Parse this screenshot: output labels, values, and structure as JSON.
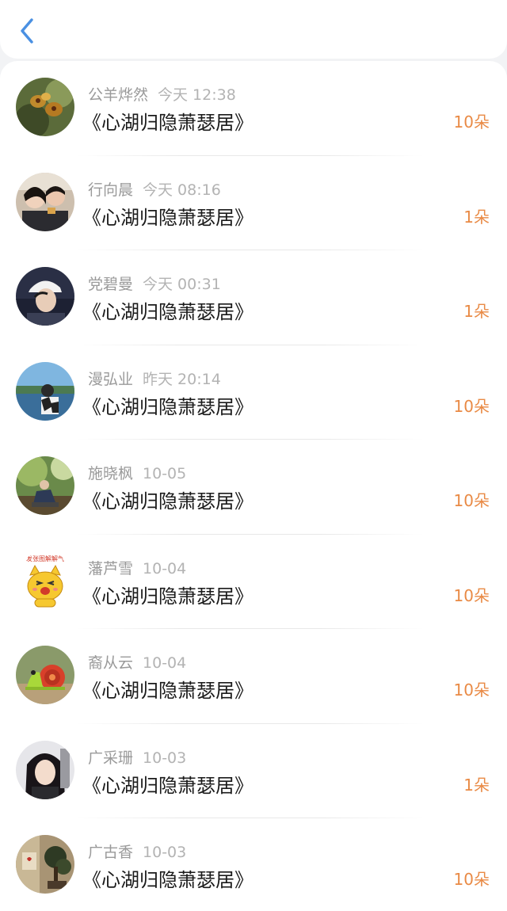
{
  "header": {
    "back_icon": "chevron-left-icon"
  },
  "list": [
    {
      "name": "公羊烨然",
      "time": "今天 12:38",
      "title": "《心湖归隐萧瑟居》",
      "count": "10朵",
      "avatar": "flower-photo"
    },
    {
      "name": "行向晨",
      "time": "今天 08:16",
      "title": "《心湖归隐萧瑟居》",
      "count": "1朵",
      "avatar": "couple-photo"
    },
    {
      "name": "党碧曼",
      "time": "今天 00:31",
      "title": "《心湖归隐萧瑟居》",
      "count": "1朵",
      "avatar": "man-cap-photo"
    },
    {
      "name": "漫弘业",
      "time": "昨天 20:14",
      "title": "《心湖归隐萧瑟居》",
      "count": "10朵",
      "avatar": "lake-photo"
    },
    {
      "name": "施晓枫",
      "time": "10-05",
      "title": "《心湖归隐萧瑟居》",
      "count": "10朵",
      "avatar": "forest-photo"
    },
    {
      "name": "藩芦雪",
      "time": "10-04",
      "title": "《心湖归隐萧瑟居》",
      "count": "10朵",
      "avatar": "cartoon-cat",
      "avatar_caption": "发张图解解气"
    },
    {
      "name": "裔从云",
      "time": "10-04",
      "title": "《心湖归隐萧瑟居》",
      "count": "10朵",
      "avatar": "snail-photo"
    },
    {
      "name": "广采珊",
      "time": "10-03",
      "title": "《心湖归隐萧瑟居》",
      "count": "1朵",
      "avatar": "woman-photo"
    },
    {
      "name": "广古香",
      "time": "10-03",
      "title": "《心湖归隐萧瑟居》",
      "count": "10朵",
      "avatar": "bonsai-photo"
    }
  ],
  "colors": {
    "accent": "#e98a45",
    "back": "#4a90e2",
    "background": "#f2f3f5"
  }
}
